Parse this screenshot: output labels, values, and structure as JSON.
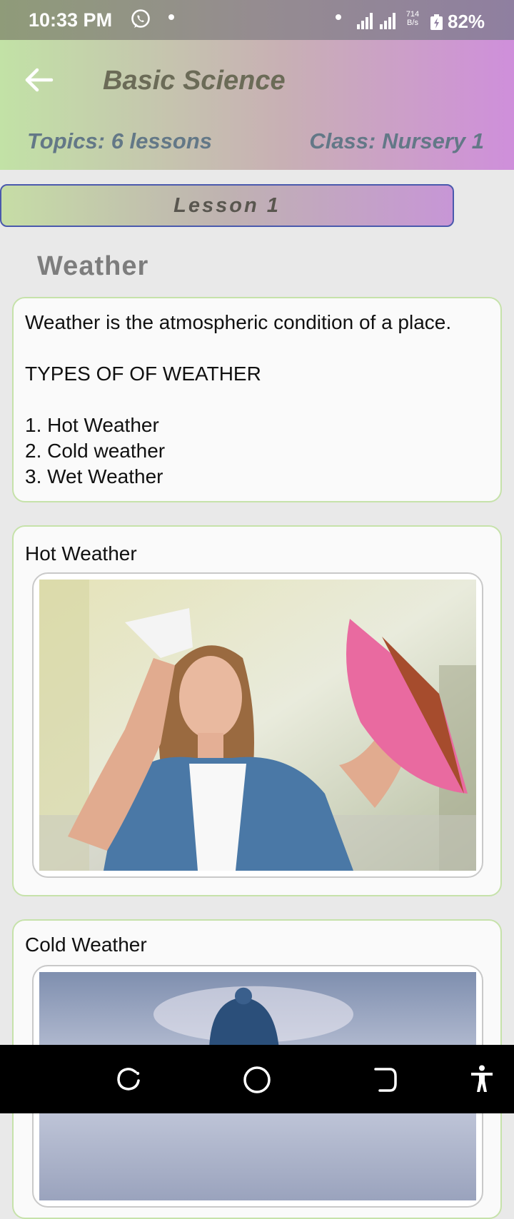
{
  "status_bar": {
    "time": "10:33 PM",
    "net_speed_value": "714",
    "net_speed_unit": "B/s",
    "battery": "82%"
  },
  "header": {
    "title": "Basic Science",
    "topics": "Topics: 6 lessons",
    "class": "Class: Nursery 1"
  },
  "lesson": {
    "label": "Lesson 1",
    "title": "Weather"
  },
  "intro_card": {
    "definition": "Weather is the atmospheric condition of a place.",
    "types_heading": "TYPES OF OF WEATHER",
    "types": [
      "1. Hot Weather",
      "2. Cold weather",
      "3. Wet Weather"
    ]
  },
  "hot_card": {
    "title": "Hot Weather"
  },
  "cold_card": {
    "title": "Cold Weather"
  },
  "colors": {
    "accent_green": "#c6e2aa",
    "accent_purple": "#cf8fdb",
    "lesson_border": "#4a59ad"
  },
  "nav": [
    "recent-apps-icon",
    "home-icon",
    "back-icon",
    "accessibility-icon"
  ]
}
